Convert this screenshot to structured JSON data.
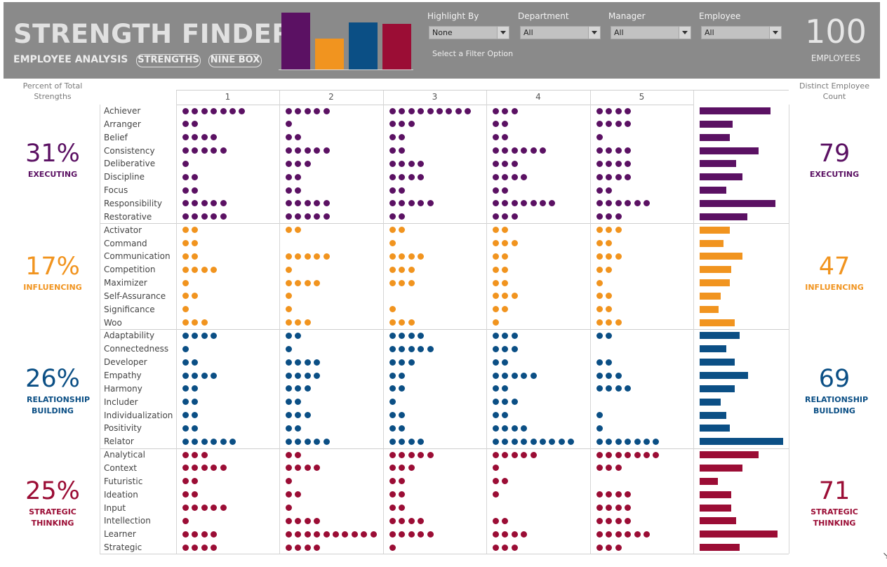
{
  "header": {
    "title": "STRENGTH FINDER",
    "subtitle": "EMPLOYEE ANALYSIS",
    "nav": {
      "strengths": "STRENGTHS",
      "ninebox": "NINE BOX"
    },
    "filters": [
      {
        "label": "Highlight By",
        "value": "None"
      },
      {
        "label": "Department",
        "value": "All"
      },
      {
        "label": "Manager",
        "value": "All"
      },
      {
        "label": "Employee",
        "value": "All"
      }
    ],
    "filter_hint": "Select a Filter Option",
    "employee_total": "100",
    "employee_label": "EMPLOYEES"
  },
  "side_headers": {
    "left": "Percent of Total Strengths",
    "right": "Distinct Employee Count"
  },
  "columns": [
    "1",
    "2",
    "3",
    "4",
    "5"
  ],
  "colors": {
    "executing": "#5b1163",
    "influencing": "#f1941f",
    "relationship": "#0b4f85",
    "strategic": "#9b0d35"
  },
  "domains": [
    {
      "key": "executing",
      "name": "EXECUTING",
      "percent": "31%",
      "count": "79",
      "strengths": [
        {
          "name": "Achiever",
          "dots": [
            7,
            5,
            9,
            3,
            4
          ],
          "employees": 71
        },
        {
          "name": "Arranger",
          "dots": [
            2,
            1,
            3,
            2,
            4
          ],
          "employees": 33
        },
        {
          "name": "Belief",
          "dots": [
            4,
            2,
            2,
            2,
            1
          ],
          "employees": 30
        },
        {
          "name": "Consistency",
          "dots": [
            5,
            5,
            2,
            6,
            4
          ],
          "employees": 59
        },
        {
          "name": "Deliberative",
          "dots": [
            1,
            3,
            4,
            3,
            4
          ],
          "employees": 37
        },
        {
          "name": "Discipline",
          "dots": [
            2,
            2,
            4,
            4,
            4
          ],
          "employees": 43
        },
        {
          "name": "Focus",
          "dots": [
            2,
            2,
            2,
            2,
            2
          ],
          "employees": 27
        },
        {
          "name": "Responsibility",
          "dots": [
            5,
            5,
            5,
            7,
            6
          ],
          "employees": 76
        },
        {
          "name": "Restorative",
          "dots": [
            5,
            5,
            2,
            3,
            3
          ],
          "employees": 48
        }
      ]
    },
    {
      "key": "influencing",
      "name": "INFLUENCING",
      "percent": "17%",
      "count": "47",
      "strengths": [
        {
          "name": "Activator",
          "dots": [
            2,
            2,
            2,
            2,
            3
          ],
          "employees": 30
        },
        {
          "name": "Command",
          "dots": [
            2,
            0,
            1,
            3,
            2
          ],
          "employees": 24
        },
        {
          "name": "Communication",
          "dots": [
            2,
            5,
            4,
            2,
            3
          ],
          "employees": 43
        },
        {
          "name": "Competition",
          "dots": [
            4,
            1,
            3,
            2,
            2
          ],
          "employees": 32
        },
        {
          "name": "Maximizer",
          "dots": [
            1,
            4,
            3,
            2,
            1
          ],
          "employees": 30
        },
        {
          "name": "Self-Assurance",
          "dots": [
            2,
            1,
            0,
            3,
            2
          ],
          "employees": 21
        },
        {
          "name": "Significance",
          "dots": [
            1,
            1,
            1,
            2,
            2
          ],
          "employees": 19
        },
        {
          "name": "Woo",
          "dots": [
            3,
            3,
            3,
            1,
            3
          ],
          "employees": 35
        }
      ]
    },
    {
      "key": "relationship",
      "name": "RELATIONSHIP BUILDING",
      "percent": "26%",
      "count": "69",
      "strengths": [
        {
          "name": "Adaptability",
          "dots": [
            4,
            2,
            4,
            3,
            2
          ],
          "employees": 40
        },
        {
          "name": "Connectedness",
          "dots": [
            1,
            1,
            5,
            3,
            0
          ],
          "employees": 27
        },
        {
          "name": "Developer",
          "dots": [
            2,
            4,
            3,
            2,
            2
          ],
          "employees": 35
        },
        {
          "name": "Empathy",
          "dots": [
            4,
            4,
            2,
            5,
            3
          ],
          "employees": 49
        },
        {
          "name": "Harmony",
          "dots": [
            2,
            3,
            2,
            2,
            4
          ],
          "employees": 35
        },
        {
          "name": "Includer",
          "dots": [
            2,
            2,
            1,
            3,
            0
          ],
          "employees": 21
        },
        {
          "name": "Individualization",
          "dots": [
            2,
            3,
            2,
            2,
            1
          ],
          "employees": 27
        },
        {
          "name": "Positivity",
          "dots": [
            2,
            2,
            2,
            4,
            1
          ],
          "employees": 30
        },
        {
          "name": "Relator",
          "dots": [
            6,
            5,
            4,
            9,
            7
          ],
          "employees": 84
        }
      ]
    },
    {
      "key": "strategic",
      "name": "STRATEGIC THINKING",
      "percent": "25%",
      "count": "71",
      "strengths": [
        {
          "name": "Analytical",
          "dots": [
            3,
            2,
            5,
            5,
            7
          ],
          "employees": 59
        },
        {
          "name": "Context",
          "dots": [
            5,
            4,
            3,
            1,
            3
          ],
          "employees": 43
        },
        {
          "name": "Futuristic",
          "dots": [
            2,
            1,
            2,
            2,
            0
          ],
          "employees": 18
        },
        {
          "name": "Ideation",
          "dots": [
            2,
            2,
            2,
            1,
            4
          ],
          "employees": 32
        },
        {
          "name": "Input",
          "dots": [
            5,
            1,
            2,
            0,
            4
          ],
          "employees": 32
        },
        {
          "name": "Intellection",
          "dots": [
            1,
            4,
            4,
            2,
            4
          ],
          "employees": 37
        },
        {
          "name": "Learner",
          "dots": [
            4,
            10,
            5,
            4,
            6
          ],
          "employees": 78
        },
        {
          "name": "Strategic",
          "dots": [
            4,
            4,
            1,
            3,
            3
          ],
          "employees": 40
        }
      ]
    }
  ]
}
